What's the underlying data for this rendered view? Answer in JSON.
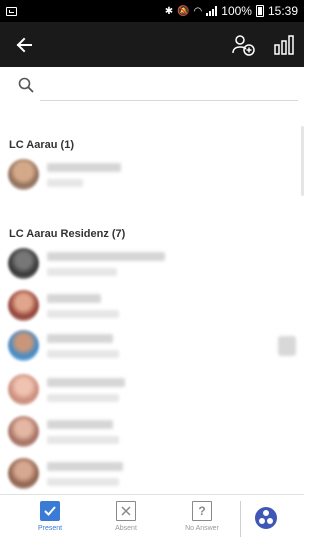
{
  "status_bar": {
    "battery": "100%",
    "time": "15:39"
  },
  "app_bar": {
    "back_icon": "arrow-left-icon",
    "add_person_icon": "person-add-icon",
    "stats_icon": "bar-chart-icon"
  },
  "search": {
    "placeholder": ""
  },
  "groups": [
    {
      "title": "LC Aarau (1)",
      "members": [
        {
          "avatar_color": "#b08a6c"
        }
      ]
    },
    {
      "title": "LC Aarau Residenz (7)",
      "members": [
        {
          "avatar_color": "#3b3b3b"
        },
        {
          "avatar_color": "#b36b5a"
        },
        {
          "avatar_color": "#5b9fd3"
        },
        {
          "avatar_color": "#d8a090"
        },
        {
          "avatar_color": "#c79a8c"
        },
        {
          "avatar_color": "#b78f7a"
        }
      ]
    }
  ],
  "bottom_bar": {
    "tabs": [
      {
        "label": "Present",
        "icon": "checkbox-checked-icon",
        "active": true
      },
      {
        "label": "Absent",
        "icon": "x-box-icon",
        "active": false
      },
      {
        "label": "No Answer",
        "icon": "question-box-icon",
        "active": false
      }
    ],
    "fab_icon": "group-icon",
    "accent": "#3a7bd5"
  }
}
